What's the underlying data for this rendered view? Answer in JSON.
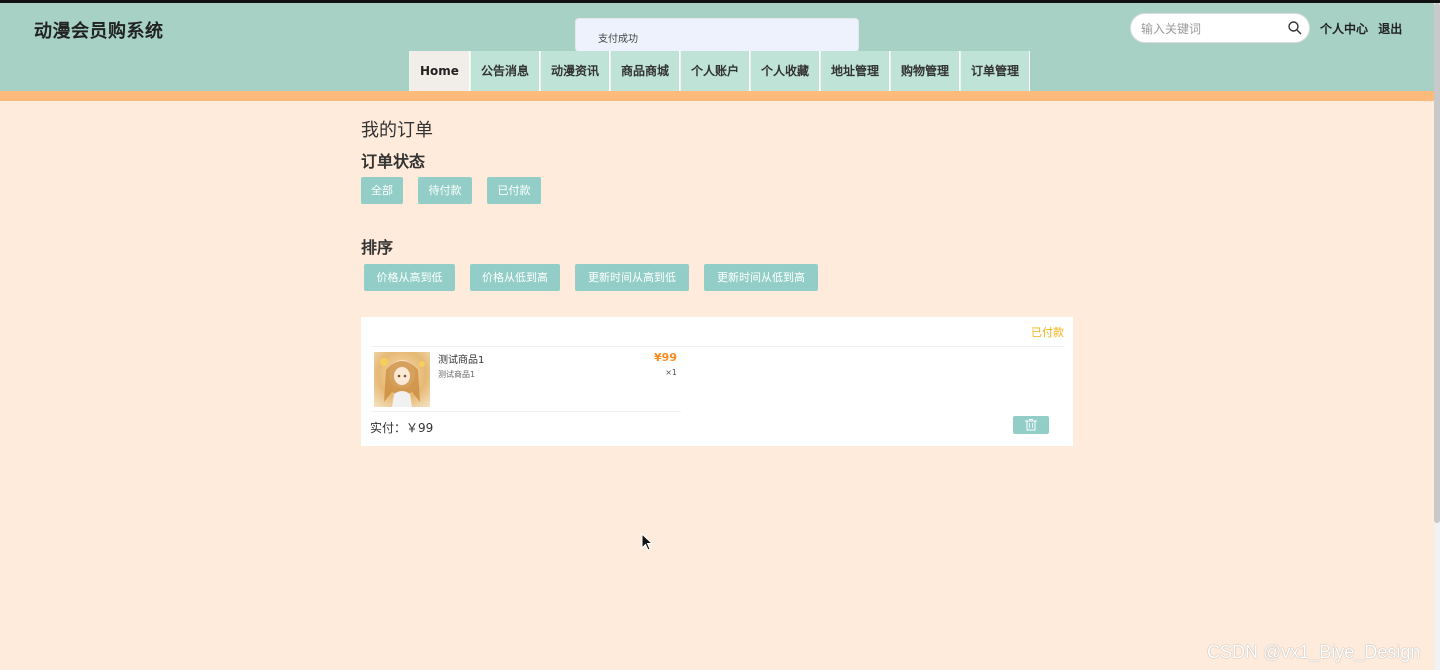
{
  "header": {
    "site_title": "动漫会员购系统",
    "toast": "支付成功",
    "search_placeholder": "输入关键词",
    "user_center": "个人中心",
    "logout": "退出"
  },
  "nav": [
    {
      "label": "Home"
    },
    {
      "label": "公告消息"
    },
    {
      "label": "动漫资讯"
    },
    {
      "label": "商品商城"
    },
    {
      "label": "个人账户"
    },
    {
      "label": "个人收藏"
    },
    {
      "label": "地址管理"
    },
    {
      "label": "购物管理"
    },
    {
      "label": "订单管理"
    }
  ],
  "main": {
    "page_title": "我的订单",
    "status_title": "订单状态",
    "status_filters": [
      "全部",
      "待付款",
      "已付款"
    ],
    "sort_title": "排序",
    "sort_options": [
      "价格从高到低",
      "价格从低到高",
      "更新时间从高到低",
      "更新时间从低到高"
    ]
  },
  "order": {
    "status": "已付款",
    "goods_name": "测试商品1",
    "goods_desc": "测试商品1",
    "price": "¥99",
    "qty": "×1",
    "paid_total": "实付：￥99"
  },
  "watermark": "CSDN @vx1_Biye_Design",
  "colors": {
    "header_bg": "#a6d1c4",
    "accent_bar": "#fcbb7a",
    "page_bg": "#ffebdb",
    "button": "#92cec7",
    "price": "#ff8a1f",
    "status": "#f3b31a"
  }
}
